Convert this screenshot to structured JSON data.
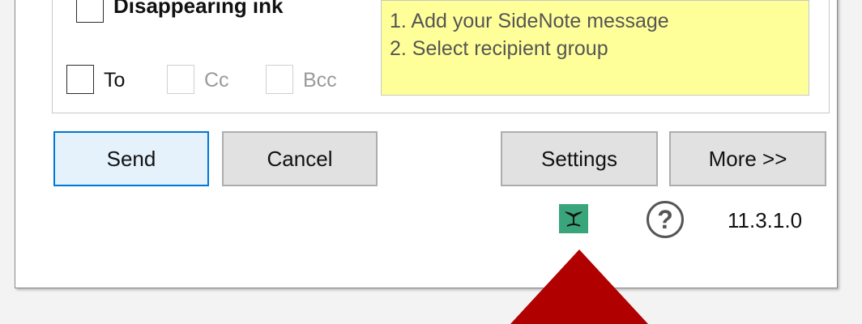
{
  "options": {
    "disappearing_ink_label": "Disappearing ink",
    "to_label": "To",
    "cc_label": "Cc",
    "bcc_label": "Bcc"
  },
  "note": {
    "line1": "1. Add your SideNote message",
    "line2": "2. Select recipient group"
  },
  "buttons": {
    "send": "Send",
    "cancel": "Cancel",
    "settings": "Settings",
    "more": "More >>"
  },
  "footer": {
    "logo_icon": "whale-tail-icon",
    "help_icon": "question-mark-icon",
    "help_glyph": "?",
    "version": "11.3.1.0"
  },
  "colors": {
    "accent": "#0078d7",
    "note_bg": "#ffff99",
    "logo_bg": "#3aa57a",
    "arrow": "#b00000"
  }
}
